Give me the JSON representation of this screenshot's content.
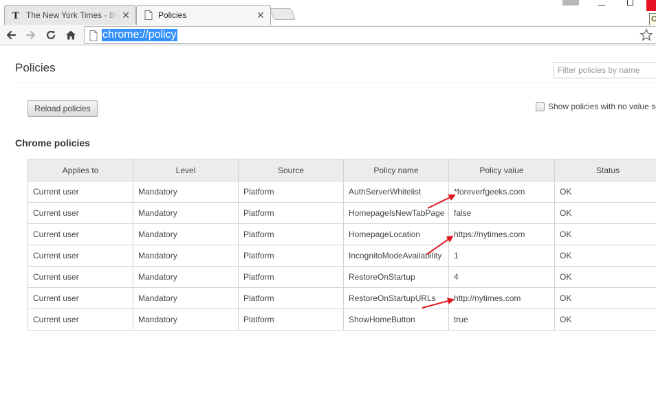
{
  "tabs": [
    {
      "title": "The New York Times - Breaking News",
      "active": false,
      "icon": "nytimes-icon"
    },
    {
      "title": "Policies",
      "active": true,
      "icon": "page-icon"
    }
  ],
  "tooltip_fragment": "C",
  "omnibox": {
    "url": "chrome://policy"
  },
  "page": {
    "title": "Policies",
    "filter_placeholder": "Filter policies by name",
    "reload_label": "Reload policies",
    "show_no_value_label": "Show policies with no value set",
    "section_title": "Chrome policies"
  },
  "table": {
    "headers": [
      "Applies to",
      "Level",
      "Source",
      "Policy name",
      "Policy value",
      "Status"
    ],
    "rows": [
      [
        "Current user",
        "Mandatory",
        "Platform",
        "AuthServerWhitelist",
        "*foreverfgeeks.com",
        "OK"
      ],
      [
        "Current user",
        "Mandatory",
        "Platform",
        "HomepageIsNewTabPage",
        "false",
        "OK"
      ],
      [
        "Current user",
        "Mandatory",
        "Platform",
        "HomepageLocation",
        "https://nytimes.com",
        "OK"
      ],
      [
        "Current user",
        "Mandatory",
        "Platform",
        "IncognitoModeAvailability",
        "1",
        "OK"
      ],
      [
        "Current user",
        "Mandatory",
        "Platform",
        "RestoreOnStartup",
        "4",
        "OK"
      ],
      [
        "Current user",
        "Mandatory",
        "Platform",
        "RestoreOnStartupURLs",
        "http://nytimes.com",
        "OK"
      ],
      [
        "Current user",
        "Mandatory",
        "Platform",
        "ShowHomeButton",
        "true",
        "OK"
      ]
    ]
  },
  "colors": {
    "selection": "#3390ff",
    "annotation_arrow": "#e0141e",
    "close_button": "#e81123"
  }
}
